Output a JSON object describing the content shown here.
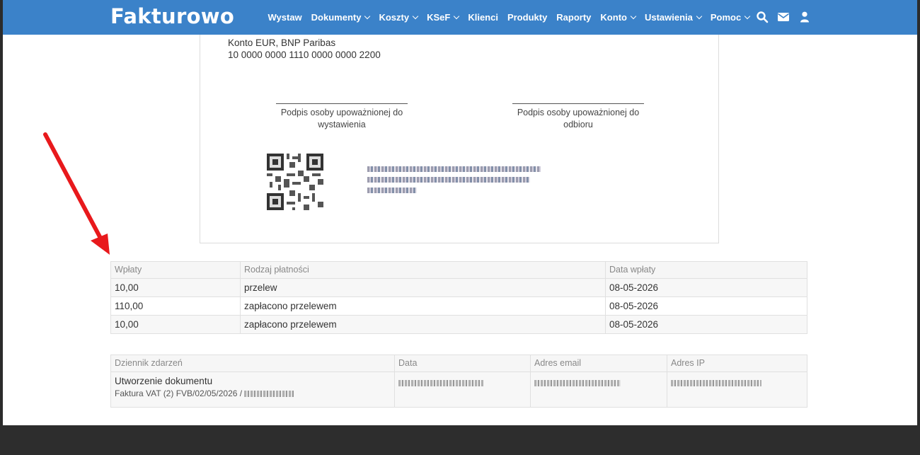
{
  "brand": {
    "logo": "Fakturowo"
  },
  "nav": {
    "items": [
      {
        "label": "Wystaw",
        "dropdown": false
      },
      {
        "label": "Dokumenty",
        "dropdown": true
      },
      {
        "label": "Koszty",
        "dropdown": true
      },
      {
        "label": "KSeF",
        "dropdown": true
      },
      {
        "label": "Klienci",
        "dropdown": false
      },
      {
        "label": "Produkty",
        "dropdown": false
      },
      {
        "label": "Raporty",
        "dropdown": false
      },
      {
        "label": "Konto",
        "dropdown": true
      },
      {
        "label": "Ustawienia",
        "dropdown": true
      },
      {
        "label": "Pomoc",
        "dropdown": true
      }
    ],
    "icons": [
      "search-icon",
      "mail-icon",
      "user-icon"
    ]
  },
  "document": {
    "bank_account_name": "Konto EUR, BNP Paribas",
    "bank_account_number": "10 0000 0000 1110 0000 0000 2200",
    "signature_issuer": "Podpis osoby upoważnionej do wystawienia",
    "signature_receiver": "Podpis osoby upoważnionej do odbioru"
  },
  "payments": {
    "headers": [
      "Wpłaty",
      "Rodzaj płatności",
      "Data wpłaty"
    ],
    "rows": [
      [
        "10,00",
        "przelew",
        "08-05-2026"
      ],
      [
        "110,00",
        "zapłacono przelewem",
        "08-05-2026"
      ],
      [
        "10,00",
        "zapłacono przelewem",
        "08-05-2026"
      ]
    ]
  },
  "event_log": {
    "headers": [
      "Dziennik zdarzeń",
      "Data",
      "Adres email",
      "Adres IP"
    ],
    "rows": [
      {
        "title": "Utworzenie dokumentu",
        "subtitle": "Faktura VAT (2) FVB/02/05/2026 /"
      }
    ]
  },
  "colors": {
    "topbar": "#3b82c9",
    "footer": "#2d2d2d",
    "annotation_arrow": "#e8191c"
  }
}
